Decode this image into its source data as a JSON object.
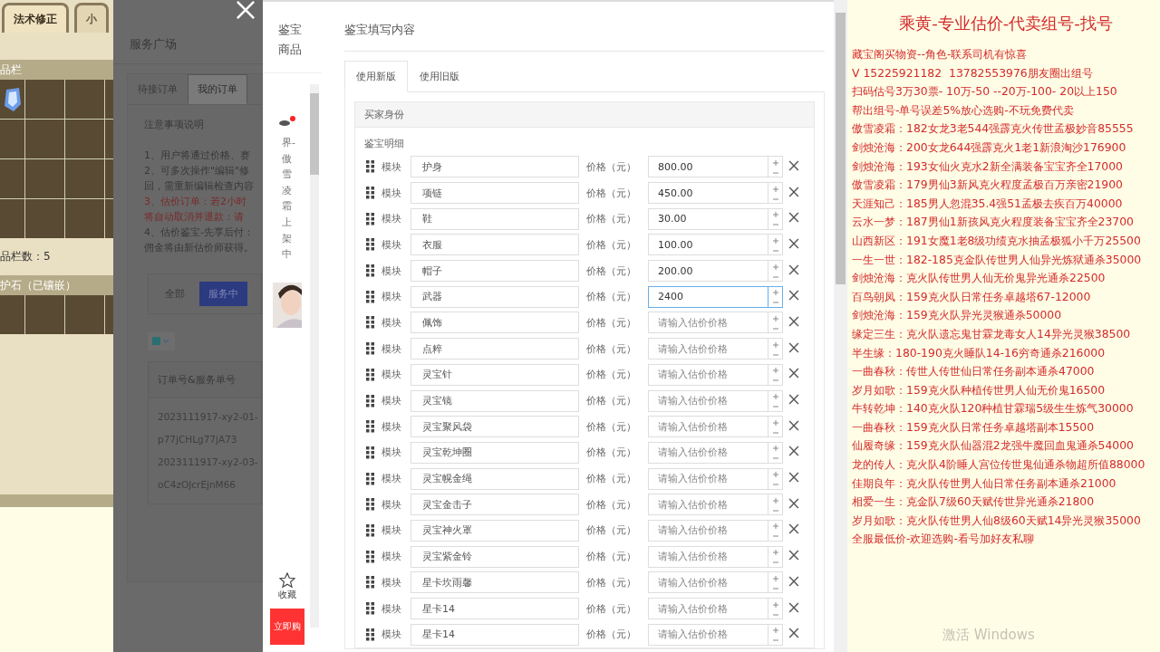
{
  "game_panel": {
    "tabs": [
      {
        "label": "法术修正",
        "selected": true
      },
      {
        "label": "小",
        "selected": false
      }
    ],
    "inventory_header": "品栏",
    "item_count": "品栏数：5",
    "stone_header": "护石（已镶嵌）"
  },
  "service_panel": {
    "title": "服务广场",
    "tabs": [
      {
        "label": "待接订单",
        "selected": false
      },
      {
        "label": "我的订单",
        "selected": true
      }
    ],
    "notice_title": "注意事项说明",
    "notice_lines": [
      {
        "text": "1、用户将通过价格、赛",
        "kind": "normal"
      },
      {
        "text": "2、可多次操作\"编辑\"修",
        "kind": "normal"
      },
      {
        "text": "回，需重新编辑检查内容",
        "kind": "normal"
      },
      {
        "text": "3、估价订单：若2小时",
        "kind": "warning"
      },
      {
        "text": "将自动取消并退款：请",
        "kind": "warning"
      },
      {
        "text": "4、估价鉴宝-先享后付：",
        "kind": "normal"
      },
      {
        "text": "佣金将由新估价师获得。",
        "kind": "normal"
      }
    ],
    "filters": [
      {
        "label": "全部",
        "selected": false
      },
      {
        "label": "服务中",
        "selected": true
      }
    ],
    "column": "订单号&服务单号",
    "orders": [
      {
        "order_no": "2023111917-xy2-01-",
        "service_no": "p77jCHLg77jA73"
      },
      {
        "order_no": "2023111917-xy2-03-",
        "service_no": "oC4zOJcrEjnM66"
      }
    ]
  },
  "product_sidebar": {
    "title": "鉴宝商品",
    "vertical_text": "界-傲雪凌霜上架中",
    "favorite": "收藏",
    "buy_button": "立即购"
  },
  "form": {
    "title": "鉴宝填写内容",
    "tabs": [
      {
        "label": "使用新版",
        "selected": true
      },
      {
        "label": "使用旧版",
        "selected": false
      }
    ],
    "section": "买家身份",
    "detail_label": "鉴宝明细",
    "rows": [
      {
        "module_label": "模块",
        "name": "护身",
        "price_label": "价格（元）",
        "value": "800.00",
        "focused": false
      },
      {
        "module_label": "模块",
        "name": "项链",
        "price_label": "价格（元）",
        "value": "450.00",
        "focused": false
      },
      {
        "module_label": "模块",
        "name": "鞋",
        "price_label": "价格（元）",
        "value": "30.00",
        "focused": false
      },
      {
        "module_label": "模块",
        "name": "衣服",
        "price_label": "价格（元）",
        "value": "100.00",
        "focused": false
      },
      {
        "module_label": "模块",
        "name": "帽子",
        "price_label": "价格（元）",
        "value": "200.00",
        "focused": false
      },
      {
        "module_label": "模块",
        "name": "武器",
        "price_label": "价格（元）",
        "value": "2400",
        "focused": true
      },
      {
        "module_label": "模块",
        "name": "佩饰",
        "price_label": "价格（元）",
        "placeholder": "请输入估价价格",
        "focused": false
      },
      {
        "module_label": "模块",
        "name": "点粹",
        "price_label": "价格（元）",
        "placeholder": "请输入估价价格",
        "focused": false
      },
      {
        "module_label": "模块",
        "name": "灵宝针",
        "price_label": "价格（元）",
        "placeholder": "请输入估价价格",
        "focused": false
      },
      {
        "module_label": "模块",
        "name": "灵宝镜",
        "price_label": "价格（元）",
        "placeholder": "请输入估价价格",
        "focused": false
      },
      {
        "module_label": "模块",
        "name": "灵宝聚风袋",
        "price_label": "价格（元）",
        "placeholder": "请输入估价价格",
        "focused": false
      },
      {
        "module_label": "模块",
        "name": "灵宝乾坤圈",
        "price_label": "价格（元）",
        "placeholder": "请输入估价价格",
        "focused": false
      },
      {
        "module_label": "模块",
        "name": "灵宝幌金绳",
        "price_label": "价格（元）",
        "placeholder": "请输入估价价格",
        "focused": false
      },
      {
        "module_label": "模块",
        "name": "灵宝金击子",
        "price_label": "价格（元）",
        "placeholder": "请输入估价价格",
        "focused": false
      },
      {
        "module_label": "模块",
        "name": "灵宝神火罩",
        "price_label": "价格（元）",
        "placeholder": "请输入估价价格",
        "focused": false
      },
      {
        "module_label": "模块",
        "name": "灵宝紫金铃",
        "price_label": "价格（元）",
        "placeholder": "请输入估价价格",
        "focused": false
      },
      {
        "module_label": "模块",
        "name": "星卡坎雨馨",
        "price_label": "价格（元）",
        "placeholder": "请输入估价价格",
        "focused": false
      },
      {
        "module_label": "模块",
        "name": "星卡14",
        "price_label": "价格（元）",
        "placeholder": "请输入估价价格",
        "focused": false
      },
      {
        "module_label": "模块",
        "name": "星卡14",
        "price_label": "价格（元）",
        "placeholder": "请输入估价价格",
        "focused": false
      }
    ]
  },
  "promo": {
    "title": "乘黄-专业估价-代卖组号-找号",
    "lines": [
      "藏宝阁买物资--角色-联系司机有惊喜",
      "V 15225921182  13782553976朋友圈出组号",
      "扫码估号3万30票- 10万-50 --20万-100- 20以上150",
      "帮出组号-单号误差5%放心选购-不玩免费代卖",
      "傲雪凌霜：182女龙3老544强霹克火传世孟极妙音85555",
      "剑烛沧海：200女龙644强霹克火1老1新浪淘沙176900",
      "剑烛沧海：193女仙火克水2新全满装备宝宝齐全17000",
      "傲雪凌霜：179男仙3新风克火程度孟极百万亲密21900",
      "天涯知己：185男人忽混35.4强51孟极去疾百万40000",
      "云水一梦：187男仙1新孩风克火程度装备宝宝齐全23700",
      "山西新区：191女魔1老8级功绩克水抽孟极狐小千万25500",
      "一生一世：182-185克金队传世男人仙异光炼狱通杀35000",
      "剑烛沧海：克火队传世男人仙无价鬼异光通杀22500",
      "百鸟朝凤：159克火队日常任务卓越塔67-12000",
      "剑烛沧海：159克火队异光灵猴通杀50000",
      "缘定三生：克火队遗忘鬼甘霖龙毒女人14异光灵猴38500",
      "半生缘：180-190克火睡队14-16穷奇通杀216000",
      "一曲春秋：传世人传世仙日常任务副本通杀47000",
      "岁月如歌：159克火队种植传世男人仙无价鬼16500",
      "牛转乾坤：140克火队120种植甘霖瑞5级生生炼气30000",
      "一曲春秋：159克火队日常任务卓越塔副本15500",
      "仙履奇缘：159克火队仙器混2龙强牛魔回血鬼通杀54000",
      "龙的传人：克火队4阶睡人宫位传世鬼仙通杀物超所值88000",
      "佳期良年：克火队传世男人仙日常任务副本通杀21000",
      "相爱一生：克金队7级60天赋传世异光通杀21800",
      "岁月如歌：克火队传世男人仙8级60天赋14异光灵猴35000",
      "全服最低价-欢迎选购-看号加好友私聊"
    ]
  },
  "os_notice": "激活 Windows"
}
